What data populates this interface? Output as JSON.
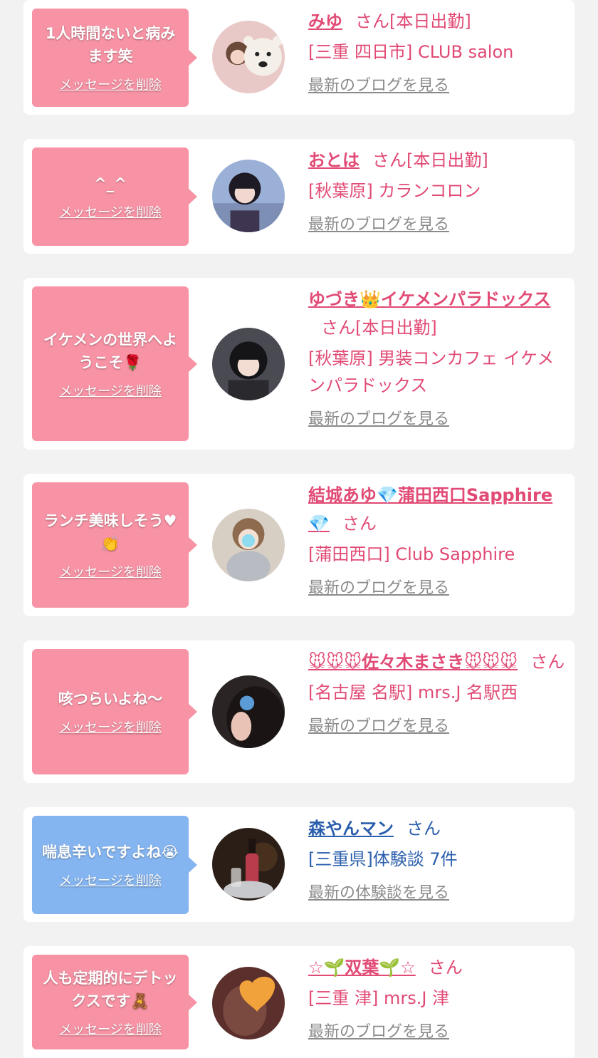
{
  "cards": [
    {
      "message": "1人時間ないと病みます笑",
      "delete_label": "メッセージを削除",
      "name": "みゆ",
      "suffix": "さん[本日出勤]",
      "place": "[三重 四日市] CLUB salon",
      "link": "最新のブログを見る",
      "theme": "pink"
    },
    {
      "message": "^_^",
      "delete_label": "メッセージを削除",
      "name": "おとは",
      "suffix": "さん[本日出勤]",
      "place": "[秋葉原] カランコロン",
      "link": "最新のブログを見る",
      "theme": "pink"
    },
    {
      "message": "イケメンの世界へようこそ🌹",
      "delete_label": "メッセージを削除",
      "name": "ゆづき👑イケメンパラドックス",
      "suffix": "さん[本日出勤]",
      "place": "[秋葉原] 男装コンカフェ イケメンパラドックス",
      "link": "最新のブログを見る",
      "theme": "pink"
    },
    {
      "message": "ランチ美味しそう♥👏",
      "delete_label": "メッセージを削除",
      "name": "結城あゆ💎蒲田西口Sapphire💎",
      "suffix": "さん",
      "place": "[蒲田西口] Club Sapphire",
      "link": "最新のブログを見る",
      "theme": "pink"
    },
    {
      "message": "咳つらいよね〜",
      "delete_label": "メッセージを削除",
      "name": "🐭🐭🐭佐々木まさき🐭🐭🐭",
      "suffix": "さん",
      "place": "[名古屋 名駅] mrs.J 名駅西",
      "link": "最新のブログを見る",
      "theme": "pink"
    },
    {
      "message": "喘息辛いですよね😭",
      "delete_label": "メッセージを削除",
      "name": "森やんマン",
      "suffix": "さん",
      "place": "[三重県]体験談 7件",
      "link": "最新の体験談を見る",
      "theme": "blue"
    },
    {
      "message": "人も定期的にデトックスです🧸",
      "delete_label": "メッセージを削除",
      "name": "☆🌱双葉🌱☆",
      "suffix": "さん",
      "place": "[三重 津] mrs.J 津",
      "link": "最新のブログを見る",
      "theme": "pink"
    }
  ],
  "avatars": [
    "avatar-photo-1",
    "avatar-photo-2",
    "avatar-photo-3",
    "avatar-photo-4",
    "avatar-photo-5",
    "avatar-photo-6",
    "avatar-photo-7"
  ]
}
